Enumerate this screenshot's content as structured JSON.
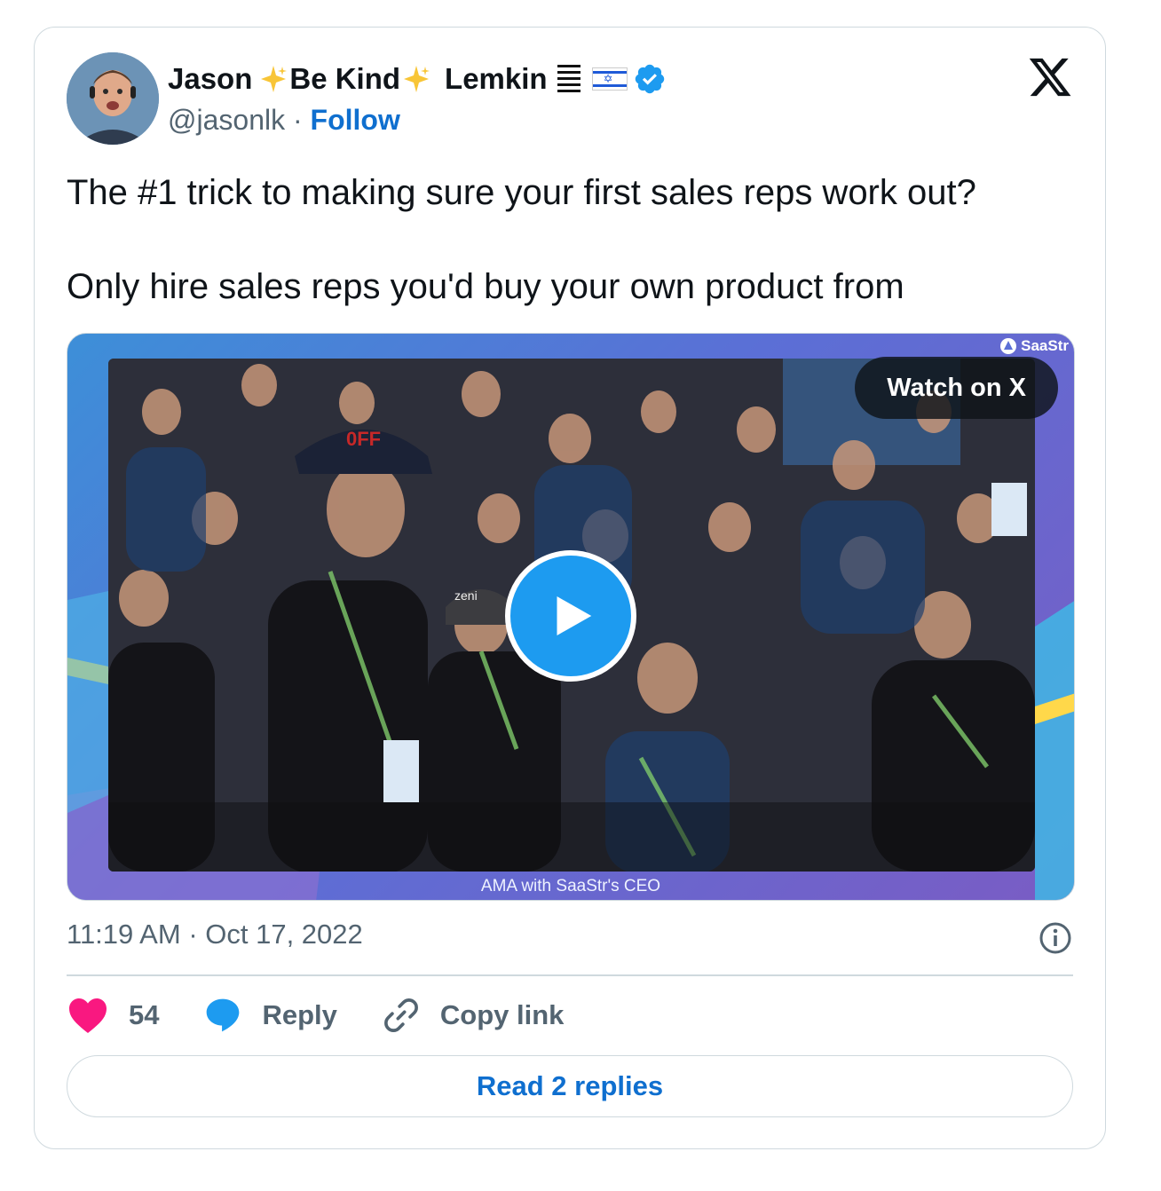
{
  "author": {
    "name_first": "Jason",
    "name_middle": "Be Kind",
    "name_last": "Lemkin",
    "handle": "@jasonlk",
    "separator": "·",
    "follow_label": "Follow"
  },
  "icons": {
    "sparkle": "sparkle-icon",
    "bars": "stacked-bars-icon",
    "flag": "israel-flag-icon",
    "verified": "verified-badge-icon",
    "x_logo": "x-logo-icon",
    "info": "info-icon",
    "like": "heart-icon",
    "reply": "speech-bubble-icon",
    "copy": "link-icon",
    "play": "play-icon"
  },
  "tweet": {
    "text": "The #1 trick to making sure your first sales reps work out?\n\nOnly hire sales reps you'd buy your own product from"
  },
  "media": {
    "watch_label": "Watch on X",
    "watermark": "SaaStr",
    "caption": "AMA with SaaStr's CEO",
    "cap_logo": "0FF",
    "hat_logo": "zeni"
  },
  "meta": {
    "time": "11:19 AM",
    "separator": "·",
    "date": "Oct 17, 2022"
  },
  "actions": {
    "like_count": "54",
    "reply_label": "Reply",
    "copy_label": "Copy link"
  },
  "read_replies_label": "Read 2 replies",
  "colors": {
    "accent": "#1d9bf0",
    "link": "#0f6fcf",
    "heart": "#f91880",
    "muted": "#536471",
    "border": "#cfd9de"
  }
}
